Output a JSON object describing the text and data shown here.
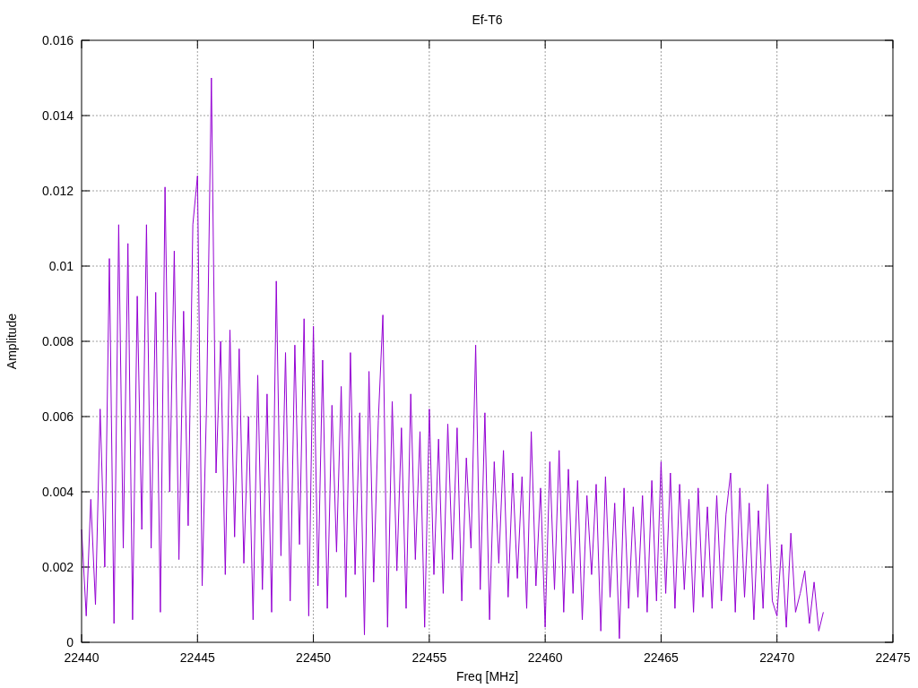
{
  "chart_data": {
    "type": "line",
    "title": "Ef-T6",
    "xlabel": "Freq [MHz]",
    "ylabel": "Amplitude",
    "grid": true,
    "xlim": [
      22440,
      22475
    ],
    "ylim": [
      0,
      0.016
    ],
    "xticks": [
      22440,
      22445,
      22450,
      22455,
      22460,
      22465,
      22470,
      22475
    ],
    "yticks": [
      0,
      0.002,
      0.004,
      0.006,
      0.008,
      0.01,
      0.012,
      0.014,
      0.016
    ],
    "x": [
      22440,
      22440.2,
      22440.4,
      22440.6,
      22440.8,
      22441,
      22441.2,
      22441.4,
      22441.6,
      22441.8,
      22442,
      22442.2,
      22442.4,
      22442.6,
      22442.8,
      22443,
      22443.2,
      22443.4,
      22443.6,
      22443.8,
      22444,
      22444.2,
      22444.4,
      22444.6,
      22444.8,
      22445,
      22445.2,
      22445.4,
      22445.6,
      22445.8,
      22446,
      22446.2,
      22446.4,
      22446.6,
      22446.8,
      22447,
      22447.2,
      22447.4,
      22447.6,
      22447.8,
      22448,
      22448.2,
      22448.4,
      22448.6,
      22448.8,
      22449,
      22449.2,
      22449.4,
      22449.6,
      22449.8,
      22450,
      22450.2,
      22450.4,
      22450.6,
      22450.8,
      22451,
      22451.2,
      22451.4,
      22451.6,
      22451.8,
      22452,
      22452.2,
      22452.4,
      22452.6,
      22452.8,
      22453,
      22453.2,
      22453.4,
      22453.6,
      22453.8,
      22454,
      22454.2,
      22454.4,
      22454.6,
      22454.8,
      22455,
      22455.2,
      22455.4,
      22455.6,
      22455.8,
      22456,
      22456.2,
      22456.4,
      22456.6,
      22456.8,
      22457,
      22457.2,
      22457.4,
      22457.6,
      22457.8,
      22458,
      22458.2,
      22458.4,
      22458.6,
      22458.8,
      22459,
      22459.2,
      22459.4,
      22459.6,
      22459.8,
      22460,
      22460.2,
      22460.4,
      22460.6,
      22460.8,
      22461,
      22461.2,
      22461.4,
      22461.6,
      22461.8,
      22462,
      22462.2,
      22462.4,
      22462.6,
      22462.8,
      22463,
      22463.2,
      22463.4,
      22463.6,
      22463.8,
      22464,
      22464.2,
      22464.4,
      22464.6,
      22464.8,
      22465,
      22465.2,
      22465.4,
      22465.6,
      22465.8,
      22466,
      22466.2,
      22466.4,
      22466.6,
      22466.8,
      22467,
      22467.2,
      22467.4,
      22467.6,
      22467.8,
      22468,
      22468.2,
      22468.4,
      22468.6,
      22468.8,
      22469,
      22469.2,
      22469.4,
      22469.6,
      22469.8,
      22470,
      22470.2,
      22470.4,
      22470.6,
      22470.8,
      22471,
      22471.2,
      22471.4,
      22471.6,
      22471.8,
      22472
    ],
    "series": [
      {
        "color": "#9400d3",
        "values": [
          0.003,
          0.0007,
          0.0038,
          0.001,
          0.0062,
          0.002,
          0.0102,
          0.0005,
          0.0111,
          0.0025,
          0.0106,
          0.0006,
          0.0092,
          0.003,
          0.0111,
          0.0025,
          0.0093,
          0.0008,
          0.0121,
          0.004,
          0.0104,
          0.0022,
          0.0088,
          0.0031,
          0.0111,
          0.0124,
          0.0015,
          0.0065,
          0.015,
          0.0045,
          0.008,
          0.0018,
          0.0083,
          0.0028,
          0.0078,
          0.0021,
          0.006,
          0.0006,
          0.0071,
          0.0014,
          0.0066,
          0.0008,
          0.0096,
          0.0023,
          0.0077,
          0.0011,
          0.0079,
          0.0026,
          0.0086,
          0.0007,
          0.0084,
          0.0015,
          0.0075,
          0.0009,
          0.0063,
          0.0024,
          0.0068,
          0.0012,
          0.0077,
          0.0018,
          0.0061,
          0.0002,
          0.0072,
          0.0016,
          0.0059,
          0.0087,
          0.0004,
          0.0064,
          0.0019,
          0.0057,
          0.0009,
          0.0066,
          0.0022,
          0.0056,
          0.0004,
          0.0062,
          0.0018,
          0.0054,
          0.0013,
          0.0058,
          0.0022,
          0.0057,
          0.0011,
          0.0049,
          0.0025,
          0.0079,
          0.0014,
          0.0061,
          0.0006,
          0.0048,
          0.0021,
          0.0051,
          0.0012,
          0.0045,
          0.0017,
          0.0044,
          0.0009,
          0.0056,
          0.0015,
          0.0041,
          0.0004,
          0.0048,
          0.0014,
          0.0051,
          0.0008,
          0.0046,
          0.0013,
          0.0043,
          0.0006,
          0.0039,
          0.0018,
          0.0042,
          0.0003,
          0.0044,
          0.0012,
          0.0037,
          0.0001,
          0.0041,
          0.0009,
          0.0036,
          0.0012,
          0.0039,
          0.0008,
          0.0043,
          0.0011,
          0.0048,
          0.0013,
          0.0045,
          0.0009,
          0.0042,
          0.0014,
          0.0038,
          0.0008,
          0.0041,
          0.0012,
          0.0036,
          0.0009,
          0.0039,
          0.0011,
          0.0034,
          0.0045,
          0.0008,
          0.0041,
          0.0012,
          0.0037,
          0.0006,
          0.0035,
          0.0009,
          0.0042,
          0.0011,
          0.0007,
          0.0026,
          0.0004,
          0.0029,
          0.0008,
          0.0013,
          0.0019,
          0.0005,
          0.0016,
          0.0003,
          0.0008
        ]
      }
    ]
  }
}
